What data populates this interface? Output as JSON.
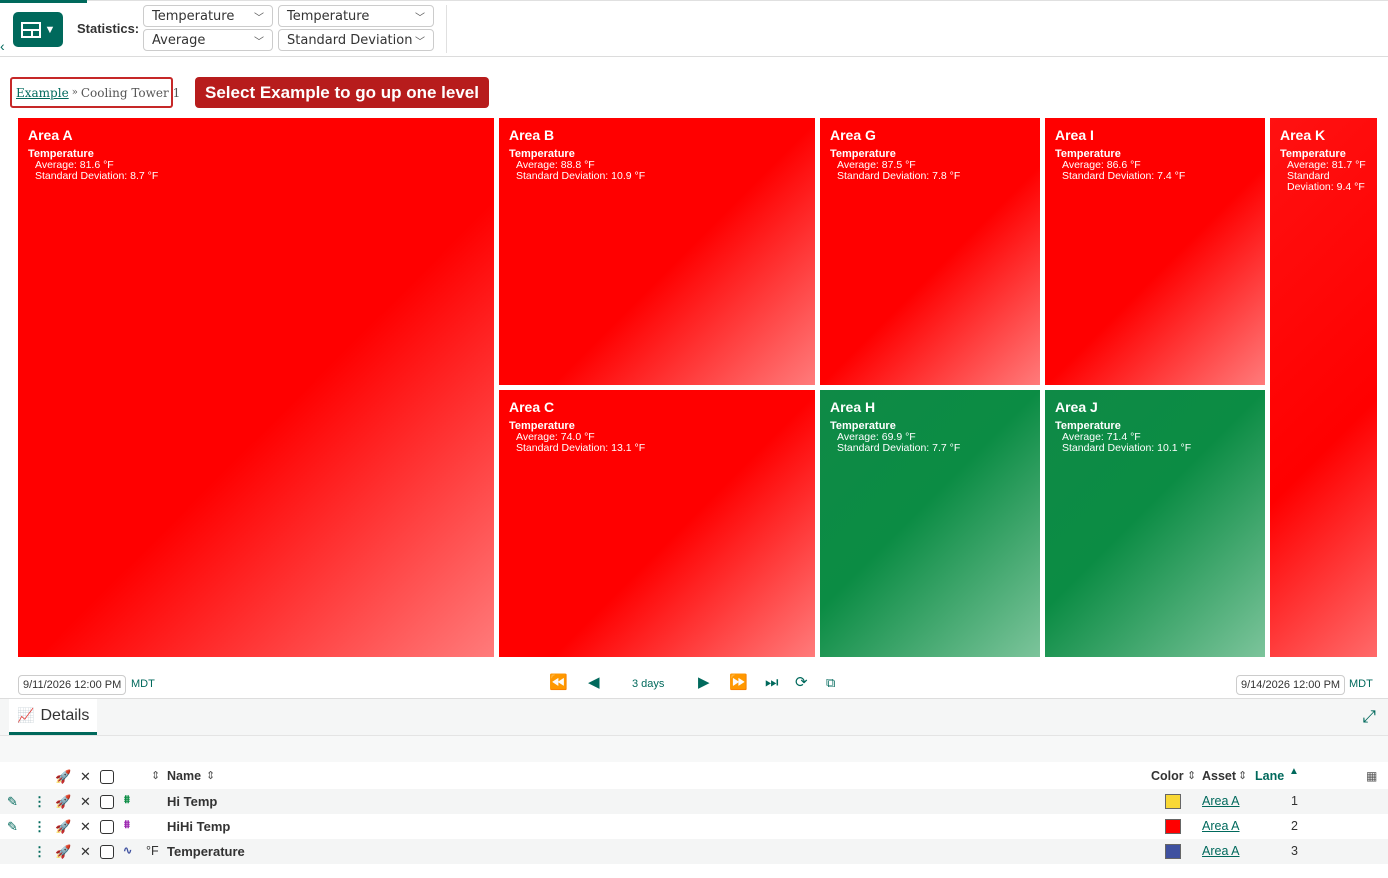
{
  "toolbar": {
    "statistics_label": "Statistics:",
    "selects": [
      {
        "value": "Temperature"
      },
      {
        "value": "Average"
      },
      {
        "value": "Temperature"
      },
      {
        "value": "Standard Deviation"
      }
    ]
  },
  "breadcrumb": {
    "parent": "Example",
    "separator": "»",
    "current": "Cooling Tower 1"
  },
  "callout": "Select Example to go up one level",
  "treemap": {
    "status_colors": {
      "hot": "#ff0000",
      "ok": "#0b8c44"
    },
    "tiles": [
      {
        "name": "Area A",
        "metric": "Temperature",
        "avg": "Average: 81.6 °F",
        "sd": "Standard Deviation: 8.7 °F",
        "status": "hot"
      },
      {
        "name": "Area B",
        "metric": "Temperature",
        "avg": "Average: 88.8 °F",
        "sd": "Standard Deviation: 10.9 °F",
        "status": "hot"
      },
      {
        "name": "Area G",
        "metric": "Temperature",
        "avg": "Average: 87.5 °F",
        "sd": "Standard Deviation: 7.8 °F",
        "status": "hot"
      },
      {
        "name": "Area I",
        "metric": "Temperature",
        "avg": "Average: 86.6 °F",
        "sd": "Standard Deviation: 7.4 °F",
        "status": "hot"
      },
      {
        "name": "Area K",
        "metric": "Temperature",
        "avg": "Average: 81.7 °F",
        "sd": "Standard Deviation: 9.4 °F",
        "status": "hot"
      },
      {
        "name": "Area C",
        "metric": "Temperature",
        "avg": "Average: 74.0 °F",
        "sd": "Standard Deviation: 13.1 °F",
        "status": "hot"
      },
      {
        "name": "Area H",
        "metric": "Temperature",
        "avg": "Average: 69.9 °F",
        "sd": "Standard Deviation: 7.7 °F",
        "status": "ok"
      },
      {
        "name": "Area J",
        "metric": "Temperature",
        "avg": "Average: 71.4 °F",
        "sd": "Standard Deviation: 10.1 °F",
        "status": "ok"
      }
    ]
  },
  "timebar": {
    "start": "9/11/2026 12:00 PM",
    "end": "9/14/2026 12:00 PM",
    "timezone": "MDT",
    "duration": "3 days"
  },
  "details": {
    "tab_label": "Details",
    "headers": {
      "name": "Name",
      "color": "Color",
      "asset": "Asset",
      "lane": "Lane"
    },
    "rows": [
      {
        "name": "Hi Temp",
        "unit": "",
        "asset": "Area A",
        "lane": "1",
        "color": "#f9d835",
        "icon": "condition-icon",
        "icon_color": "#0b8c44"
      },
      {
        "name": "HiHi Temp",
        "unit": "",
        "asset": "Area A",
        "lane": "2",
        "color": "#ff0000",
        "icon": "condition-icon",
        "icon_color": "#9c27b0"
      },
      {
        "name": "Temperature",
        "unit": "°F",
        "asset": "Area A",
        "lane": "3",
        "color": "#3f51a0",
        "icon": "signal-icon",
        "icon_color": "#3f51a0"
      }
    ]
  }
}
